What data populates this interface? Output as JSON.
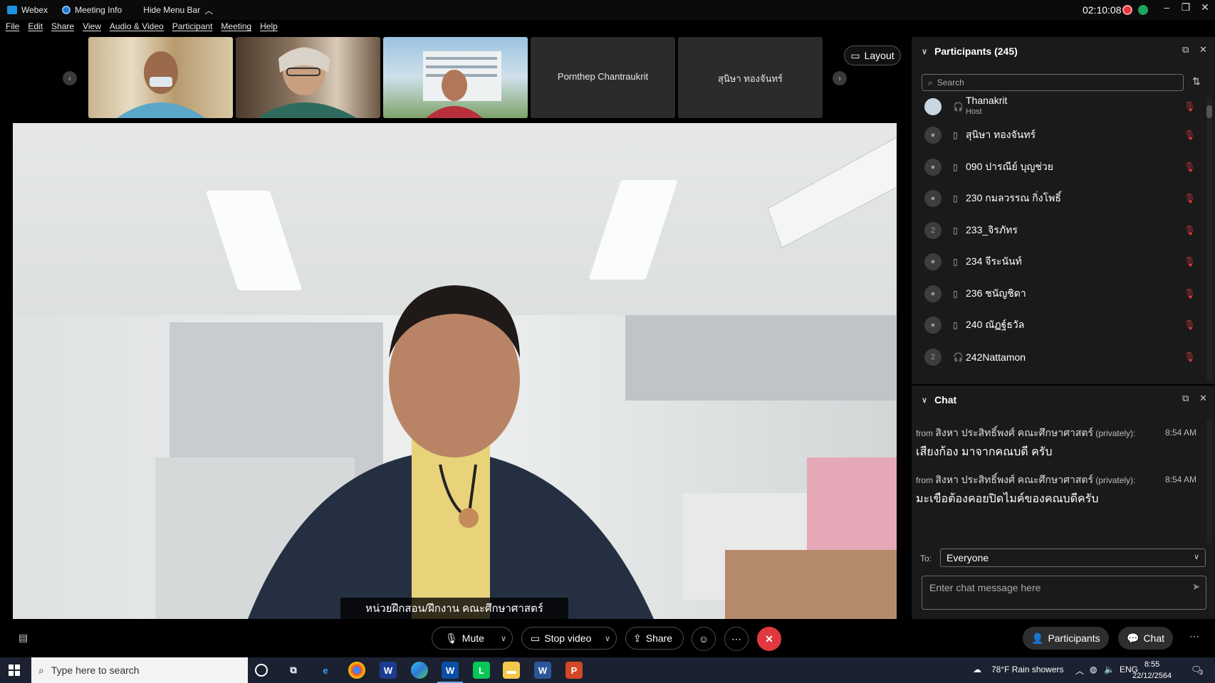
{
  "titlebar": {
    "app_name": "Webex",
    "meeting_info": "Meeting Info",
    "hide_menu": "Hide Menu Bar",
    "clock": "02:10:08"
  },
  "menu": [
    "File",
    "Edit",
    "Share",
    "View",
    "Audio & Video",
    "Participant",
    "Meeting",
    "Help"
  ],
  "thumbnails": [
    {
      "name": "",
      "kind": "video"
    },
    {
      "name": "",
      "kind": "video"
    },
    {
      "name": "",
      "kind": "video"
    },
    {
      "name": "Pornthep Chantraukrit",
      "kind": "name"
    },
    {
      "name": "สุนิษา ทองจันทร์",
      "kind": "name"
    }
  ],
  "layout_label": "Layout",
  "caption": "หน่วยฝึกสอน/ฝึกงาน คณะศึกษาศาสตร์",
  "participants": {
    "title": "Participants (245)",
    "search_placeholder": "Search",
    "list": [
      {
        "name": "Thanakrit",
        "role": "Host",
        "avatar": "",
        "device": "headset"
      },
      {
        "name": "สุนิษา ทองจันทร์",
        "role": "",
        "avatar": "",
        "device": "phone"
      },
      {
        "name": "090 ปารณีย์ บุญช่วย",
        "role": "",
        "avatar": "",
        "device": "phone"
      },
      {
        "name": "230 กมลวรรณ กิ่งโพธิ์",
        "role": "",
        "avatar": "",
        "device": "phone"
      },
      {
        "name": "233_จิรภัทร",
        "role": "",
        "avatar": "2",
        "device": "phone"
      },
      {
        "name": "234 จีระนันท์",
        "role": "",
        "avatar": "",
        "device": "phone"
      },
      {
        "name": "236 ชนัญชิดา",
        "role": "",
        "avatar": "",
        "device": "phone"
      },
      {
        "name": "240 ณัฏฐ์ธวัล",
        "role": "",
        "avatar": "",
        "device": "phone"
      },
      {
        "name": "242Nattamon",
        "role": "",
        "avatar": "2",
        "device": "headset"
      }
    ]
  },
  "chat": {
    "title": "Chat",
    "messages": [
      {
        "from": "from",
        "sender": "สิงหา ประสิทธิ์พงศ์ คณะศึกษาศาสตร์",
        "privately": "(privately):",
        "time": "8:54 AM",
        "text": "เสียงก้อง มาจากคณบดี ครับ"
      },
      {
        "from": "from",
        "sender": "สิงหา ประสิทธิ์พงศ์ คณะศึกษาศาสตร์",
        "privately": "(privately):",
        "time": "8:54 AM",
        "text": "มะเขือต้องคอยปิดไมค์ของคณบดีครับ"
      }
    ],
    "to_label": "To:",
    "to_value": "Everyone",
    "input_placeholder": "Enter chat message here"
  },
  "controls": {
    "mute": "Mute",
    "stop_video": "Stop video",
    "share": "Share",
    "participants": "Participants",
    "chat": "Chat"
  },
  "taskbar": {
    "search_placeholder": "Type here to search",
    "weather": "78°F  Rain showers",
    "lang": "ENG",
    "time": "8:55",
    "date": "22/12/2564",
    "notif_count": "3"
  },
  "colors": {
    "end_call": "#e0383e",
    "mute_indicator": "#e0383e",
    "panel_bg": "#1a1a1a"
  }
}
